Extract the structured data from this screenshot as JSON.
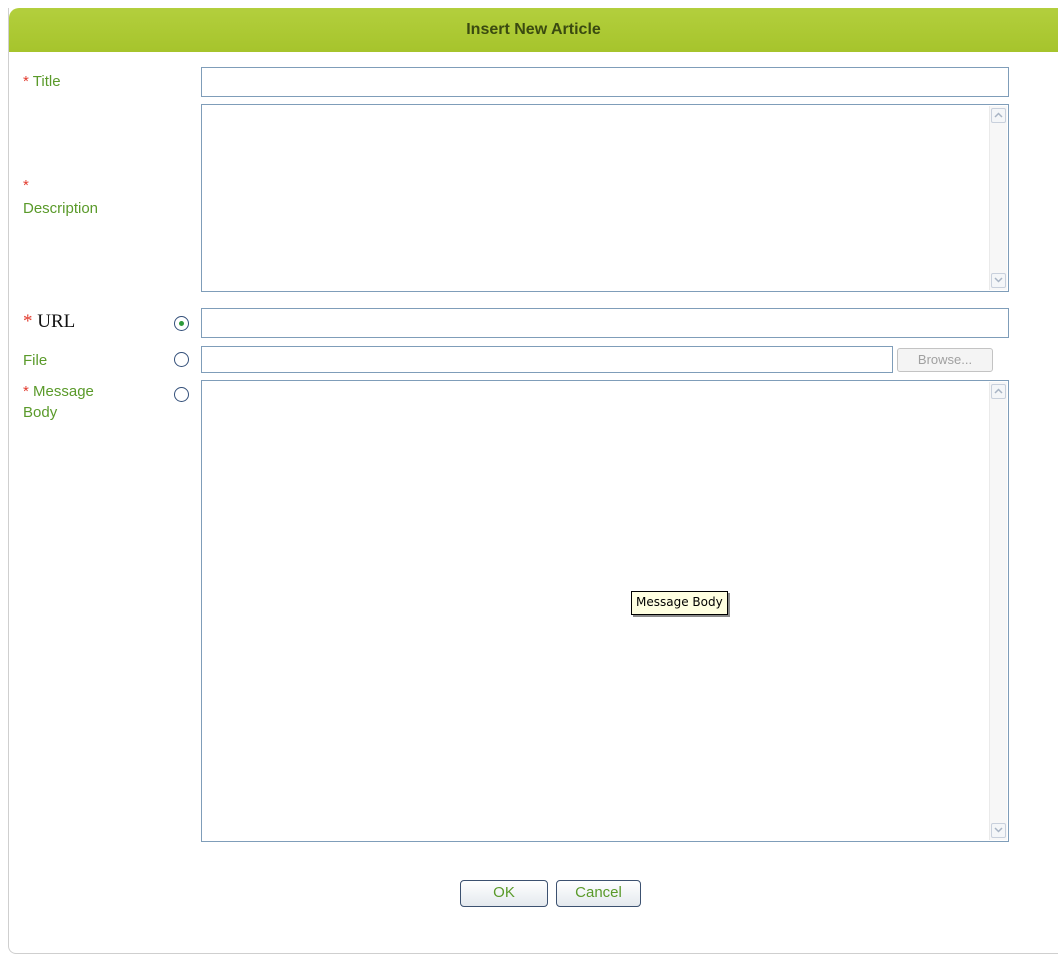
{
  "dialog": {
    "title": "Insert New Article"
  },
  "form": {
    "title": {
      "required_mark": "*",
      "label": "Title",
      "value": ""
    },
    "description": {
      "required_mark": "*",
      "label": "Description",
      "value": ""
    },
    "url": {
      "required_mark": "*",
      "label": "URL",
      "selected": true,
      "value": ""
    },
    "file": {
      "label": "File",
      "selected": false,
      "value": "",
      "browse_label": "Browse..."
    },
    "message_body": {
      "required_mark": "*",
      "label_line1": "Message",
      "label_line2": "Body",
      "selected": false,
      "value": ""
    }
  },
  "tooltip": {
    "text": "Message Body"
  },
  "buttons": {
    "ok": "OK",
    "cancel": "Cancel"
  },
  "icons": {
    "scroll_up": "chevron-up-icon",
    "scroll_down": "chevron-down-icon",
    "radio_selected": "radio-selected-icon",
    "radio_unselected": "radio-unselected-icon"
  },
  "colors": {
    "title_bar": "#a6c42c",
    "label_green": "#5a9a2a",
    "required_red": "#e23b2e",
    "field_border": "#7f9db9"
  }
}
